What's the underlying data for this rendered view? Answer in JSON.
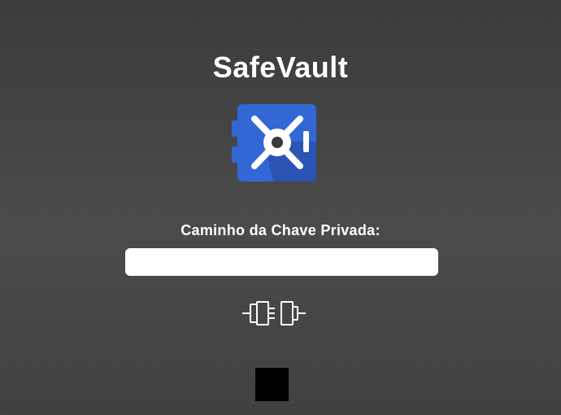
{
  "app": {
    "title": "SafeVault",
    "logo_icon": "safe-vault-logo-icon",
    "logo_color": "#3367d6"
  },
  "form": {
    "private_key_label": "Caminho da Chave Privada:",
    "private_key_value": "",
    "private_key_placeholder": ""
  },
  "actions": {
    "connect_icon": "plug-connect-icon"
  },
  "colors": {
    "background": "#444444",
    "text": "#ffffff",
    "input_background": "#ffffff",
    "logo_blue": "#3367d6",
    "logo_shadow": "#2a52b0"
  }
}
